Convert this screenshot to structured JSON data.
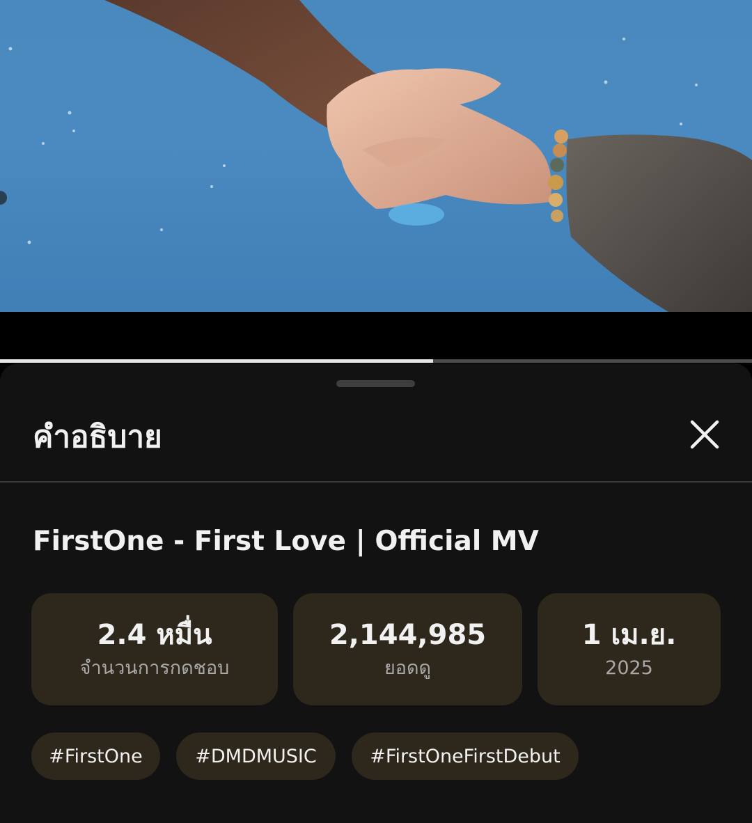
{
  "player": {
    "progress_fraction": 0.576
  },
  "description_panel": {
    "header_title": "คำอธิบาย",
    "close_icon": "close-icon",
    "video_title": "FirstOne - First Love | Official MV",
    "stats": [
      {
        "value": "2.4 หมื่น",
        "label": "จำนวนการกดชอบ"
      },
      {
        "value": "2,144,985",
        "label": "ยอดดู"
      },
      {
        "value": "1 เม.ย.",
        "label": "2025"
      }
    ],
    "hashtags": [
      "#FirstOne",
      "#DMDMUSIC",
      "#FirstOneFirstDebut"
    ]
  },
  "colors": {
    "sheet_background": "#121212",
    "card_background": "#2e271b",
    "text_primary": "#f1f1f1",
    "text_secondary": "#a8a8a8",
    "progress_fill": "#e6e6e6",
    "progress_track": "#4b4b4b"
  }
}
